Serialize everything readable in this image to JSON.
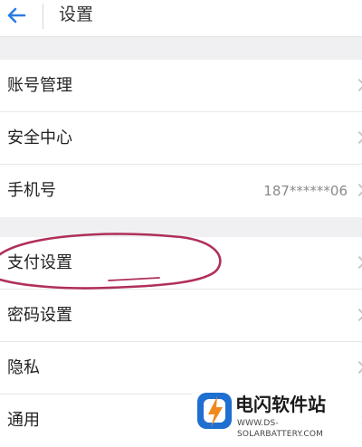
{
  "header": {
    "title": "设置",
    "back_icon": "arrow-left-icon",
    "accent_color": "#2a7de1"
  },
  "account_section": [
    {
      "label": "账号管理",
      "value": ""
    },
    {
      "label": "安全中心",
      "value": ""
    },
    {
      "label": "手机号",
      "value": "187******06"
    }
  ],
  "general_section": [
    {
      "label": "支付设置",
      "value": ""
    },
    {
      "label": "密码设置",
      "value": ""
    },
    {
      "label": "隐私",
      "value": ""
    },
    {
      "label": "通用",
      "value": ""
    }
  ],
  "annotation": {
    "color": "#b0305a",
    "target": "支付设置"
  },
  "watermark": {
    "name": "电闪软件站",
    "url": "WWW.DS-SOLARBATTERY.COM"
  }
}
